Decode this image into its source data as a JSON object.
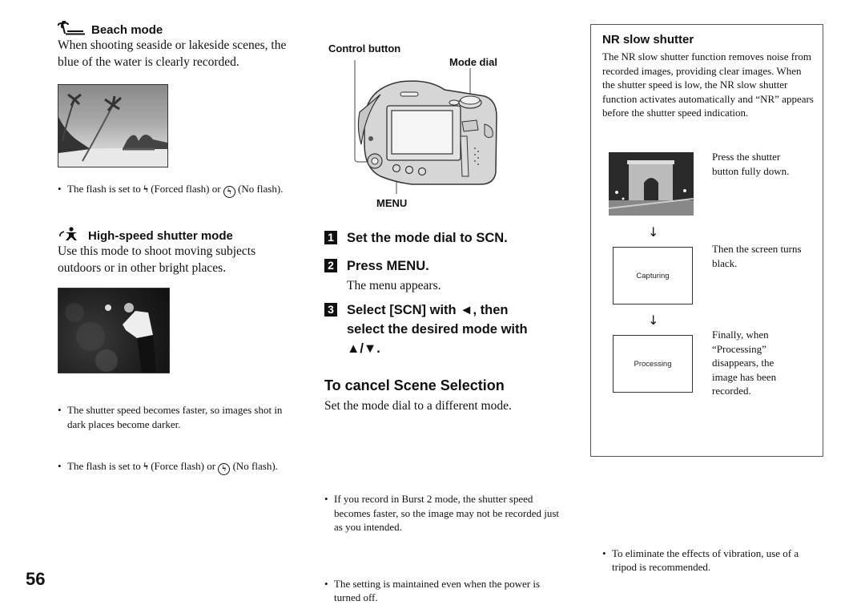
{
  "beach": {
    "icon": "beach-mode-icon",
    "title": "Beach mode",
    "description": "When shooting seaside or lakeside scenes, the blue of the water is clearly recorded.",
    "photo_alt": "Beach with palm trees",
    "note_prefix": "The flash is set to",
    "note_forced": "(Forced flash) or",
    "note_no": "(No flash)."
  },
  "highspeed": {
    "icon": "high-speed-shutter-icon",
    "title": "High-speed shutter mode",
    "description": "Use this mode to shoot moving subjects outdoors or in other bright places.",
    "photo_alt": "Golfer swinging",
    "note1": "The shutter speed becomes faster, so images shot in dark places become darker.",
    "note2_prefix": "The flash is set to",
    "note2_forced": "(Force flash) or",
    "note2_no": "(No flash)."
  },
  "camera_diagram": {
    "label_control": "Control button",
    "label_mode_dial": "Mode dial",
    "label_menu": "MENU"
  },
  "steps": [
    {
      "number": "1",
      "text": "Set the mode dial to SCN."
    },
    {
      "number": "2",
      "text": "Press MENU.",
      "sub": "The menu appears."
    },
    {
      "number": "3",
      "text": "Select [SCN] with ◄, then select the desired mode with ▲/▼."
    }
  ],
  "cancel": {
    "title": "To cancel Scene Selection",
    "text": "Set the mode dial to a different mode.",
    "notes": [
      "If you record in Burst 2 mode, the shutter speed becomes faster, so the image may not be recorded just as you intended.",
      "The setting is maintained even when the power is turned off."
    ]
  },
  "nr_box": {
    "title": "NR slow shutter",
    "description": "The NR slow shutter function removes noise from recorded images, providing clear images. When the shutter speed is low, the NR slow shutter function activates automatically and “NR” appears before the shutter speed indication.",
    "step1_text": "Press the shutter button fully down.",
    "screen2_label": "Capturing",
    "step2_text": "Then the screen turns black.",
    "screen3_label": "Processing",
    "step3_text": "Finally, when “Processing” disappears, the image has been recorded.",
    "note": "To eliminate the effects of vibration, use of a tripod is recommended."
  },
  "page_number": "56"
}
